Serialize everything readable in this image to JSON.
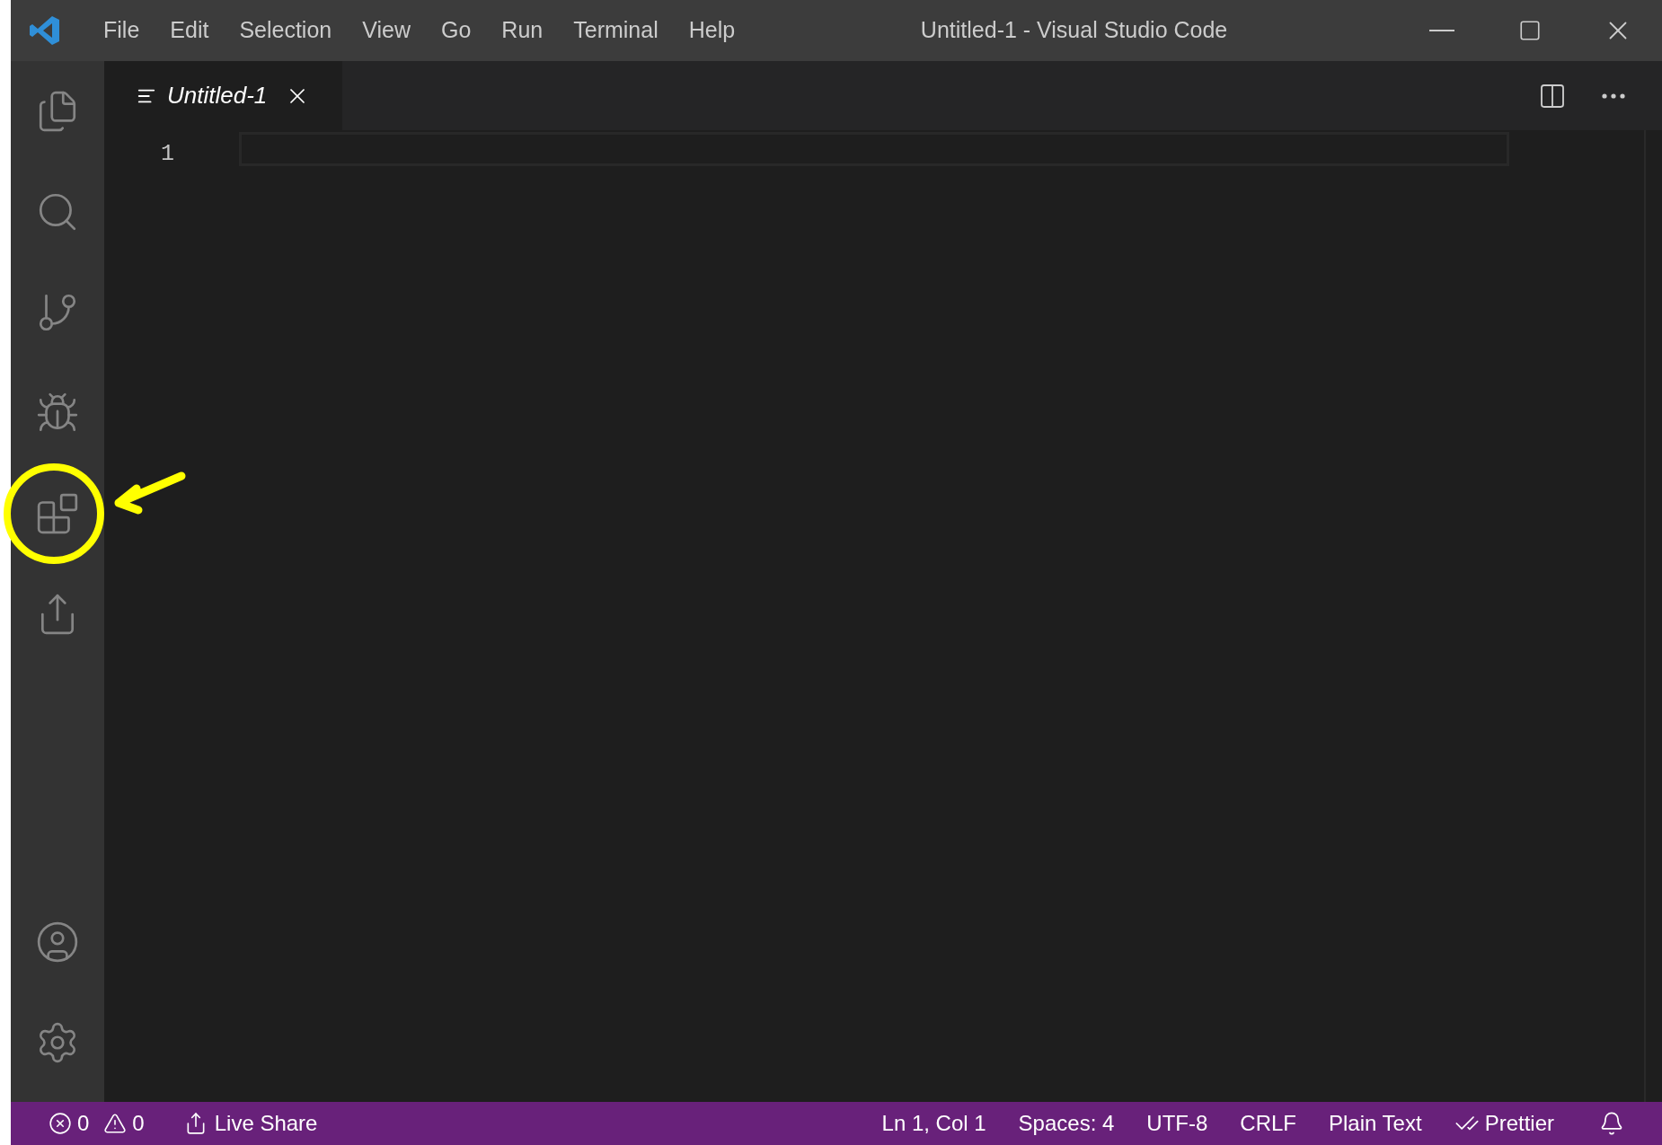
{
  "window": {
    "title": "Untitled-1 - Visual Studio Code"
  },
  "menu": [
    "File",
    "Edit",
    "Selection",
    "View",
    "Go",
    "Run",
    "Terminal",
    "Help"
  ],
  "activity_bar": {
    "top": [
      {
        "kind": "files"
      },
      {
        "kind": "search"
      },
      {
        "kind": "source-control"
      },
      {
        "kind": "run-debug"
      },
      {
        "kind": "extensions",
        "highlighted": true
      },
      {
        "kind": "live-share"
      }
    ],
    "bottom": [
      {
        "kind": "account"
      },
      {
        "kind": "settings"
      }
    ]
  },
  "tabs": [
    {
      "label": "Untitled-1",
      "selected": true,
      "preview": true
    }
  ],
  "editor": {
    "line_numbers": [
      "1"
    ]
  },
  "status_bar": {
    "errors": "0",
    "warnings": "0",
    "left": [
      {
        "kind": "live-share",
        "label": "Live Share"
      }
    ],
    "right": [
      {
        "kind": "text",
        "label": "Ln 1, Col 1"
      },
      {
        "kind": "text",
        "label": "Spaces: 4"
      },
      {
        "kind": "text",
        "label": "UTF-8"
      },
      {
        "kind": "text",
        "label": "CRLF"
      },
      {
        "kind": "text",
        "label": "Plain Text"
      },
      {
        "kind": "prettier",
        "label": "Prettier"
      }
    ]
  }
}
